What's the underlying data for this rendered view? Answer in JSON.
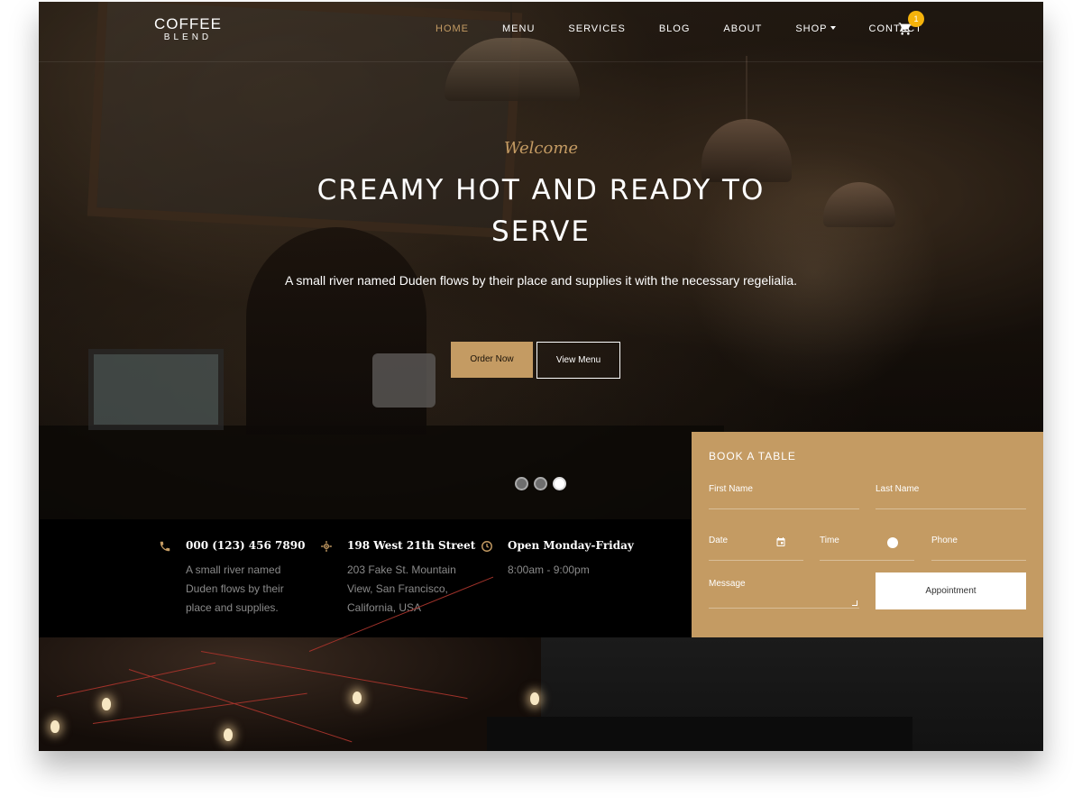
{
  "brand": {
    "top": "COFFEE",
    "bottom": "BLEND"
  },
  "nav": {
    "items": [
      {
        "label": "HOME"
      },
      {
        "label": "MENU"
      },
      {
        "label": "SERVICES"
      },
      {
        "label": "BLOG"
      },
      {
        "label": "ABOUT"
      },
      {
        "label": "SHOP"
      },
      {
        "label": "CONTACT"
      }
    ],
    "cart_count": "1",
    "cart_icon": "shopping-cart-icon"
  },
  "hero": {
    "welcome": "Welcome",
    "headline": "CREAMY HOT AND READY TO SERVE",
    "subtext": "A small river named Duden flows by their place and supplies it with the necessary regelialia.",
    "order_button": "Order Now",
    "menu_button": "View Menu",
    "slides": 3,
    "active_slide": 3
  },
  "info": [
    {
      "icon": "phone-icon",
      "title": "000 (123) 456 7890",
      "desc": "A small river named Duden flows by their place and supplies."
    },
    {
      "icon": "location-icon",
      "title": "198 West 21th Street",
      "desc": "203 Fake St. Mountain View, San Francisco, California, USA"
    },
    {
      "icon": "clock-icon",
      "title": "Open Monday-Friday",
      "desc": "8:00am - 9:00pm"
    }
  ],
  "booking": {
    "title": "BOOK A TABLE",
    "first_name": "First Name",
    "last_name": "Last Name",
    "date": "Date",
    "time": "Time",
    "phone": "Phone",
    "message": "Message",
    "submit": "Appointment"
  },
  "colors": {
    "accent": "#c49b63",
    "badge": "#f5b30b",
    "dark": "#000000"
  }
}
